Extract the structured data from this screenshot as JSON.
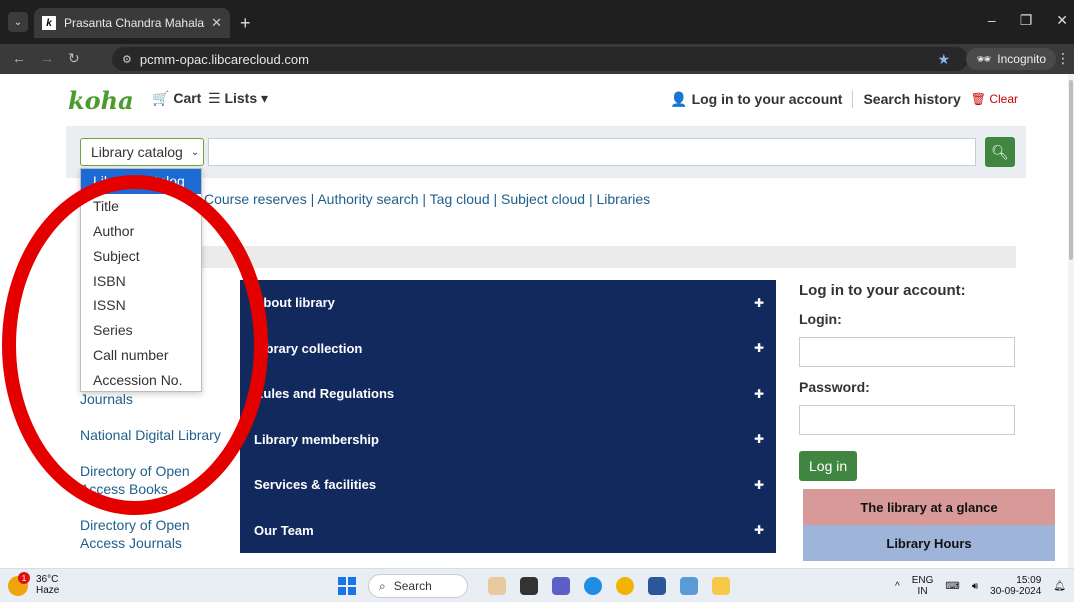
{
  "browser": {
    "tab_title": "Prasanta Chandra Mahalanobis",
    "tab_favicon_letter": "k",
    "url": "pcmm-opac.libcarecloud.com",
    "incognito_label": "Incognito"
  },
  "header": {
    "logo": "koha",
    "cart": "Cart",
    "lists": "Lists",
    "login": "Log in to your account",
    "history": "Search history",
    "clear": "Clear"
  },
  "search": {
    "selected": "Library catalog",
    "options": [
      "Library catalog",
      "Title",
      "Author",
      "Subject",
      "ISBN",
      "ISSN",
      "Series",
      "Call number",
      "Accession No."
    ]
  },
  "quicklinks": "Course reserves | Authority search | Tag cloud | Subject cloud | Libraries",
  "left_links": [
    "Journals",
    "National Digital Library",
    "Directory of Open Access Books",
    "Directory of Open Access Journals"
  ],
  "accordion": [
    "About library",
    "Library collection",
    "Rules and Regulations",
    "Library membership",
    "Services & facilities",
    "Our Team"
  ],
  "login_panel": {
    "title": "Log in to your account:",
    "login_label": "Login:",
    "password_label": "Password:",
    "button": "Log in"
  },
  "info_boxes": {
    "glance": "The library at a glance",
    "hours": "Library Hours"
  },
  "taskbar": {
    "weather_temp": "36°C",
    "weather_desc": "Haze",
    "weather_badge": "1",
    "search": "Search",
    "lang1": "ENG",
    "lang2": "IN",
    "time": "15:09",
    "date": "30-09-2024"
  },
  "colors": {
    "accent_green": "#408540",
    "navy": "#12295e",
    "link_blue": "#1f5f8b",
    "annotation_red": "#e50000"
  }
}
